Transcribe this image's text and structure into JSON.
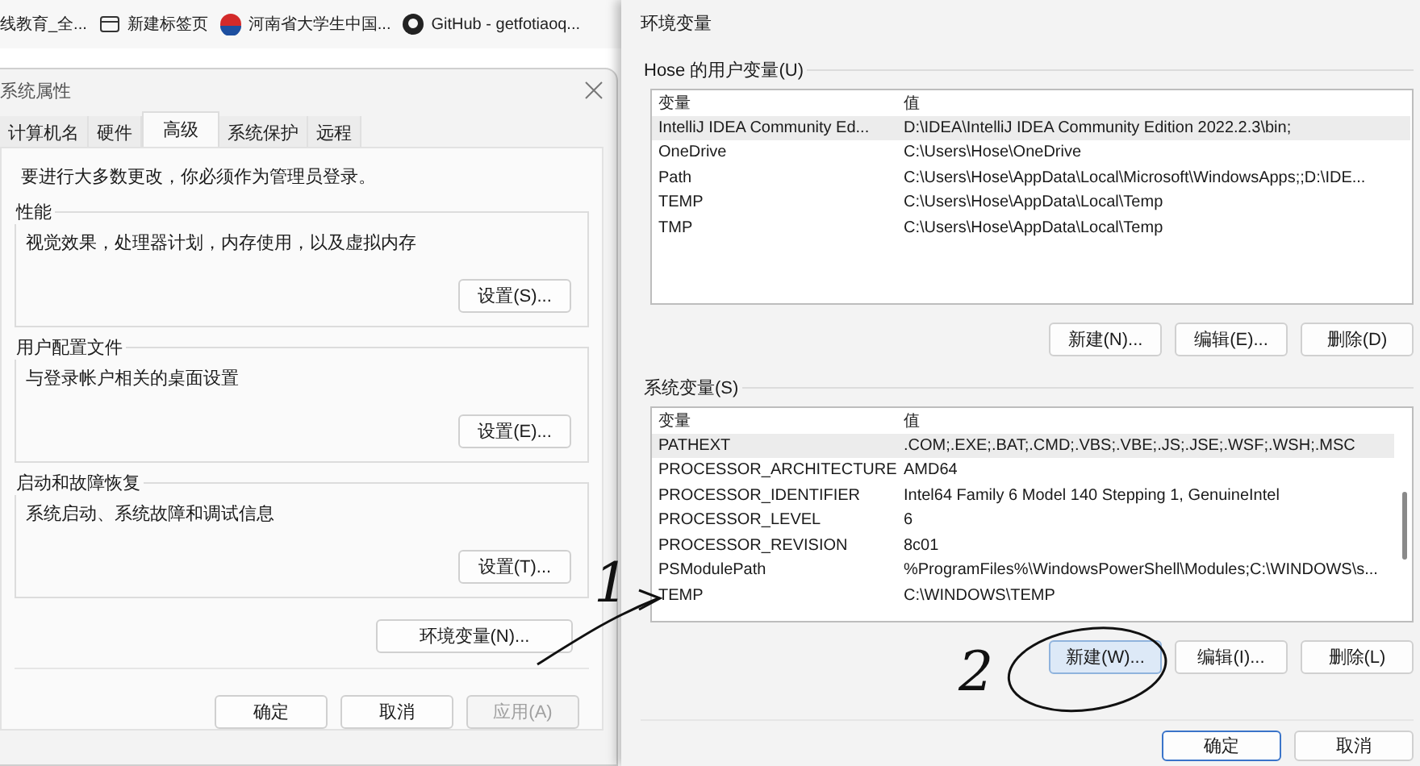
{
  "bookmarks": [
    {
      "label": "线教育_全...",
      "kind": "none"
    },
    {
      "label": "新建标签页",
      "kind": "tab"
    },
    {
      "label": "河南省大学生中国...",
      "kind": "logo"
    },
    {
      "label": "GitHub - getfotiaoq...",
      "kind": "github"
    }
  ],
  "system_properties": {
    "title": "系统属性",
    "tabs": [
      {
        "label": "计算机名",
        "selected": false
      },
      {
        "label": "硬件",
        "selected": false
      },
      {
        "label": "高级",
        "selected": true
      },
      {
        "label": "系统保护",
        "selected": false
      },
      {
        "label": "远程",
        "selected": false
      }
    ],
    "admin_note": "要进行大多数更改，你必须作为管理员登录。",
    "groups": [
      {
        "title": "性能",
        "description": "视觉效果，处理器计划，内存使用，以及虚拟内存",
        "button": "设置(S)..."
      },
      {
        "title": "用户配置文件",
        "description": "与登录帐户相关的桌面设置",
        "button": "设置(E)..."
      },
      {
        "title": "启动和故障恢复",
        "description": "系统启动、系统故障和调试信息",
        "button": "设置(T)..."
      }
    ],
    "env_button": "环境变量(N)...",
    "buttons": [
      {
        "label": "确定",
        "disabled": false
      },
      {
        "label": "取消",
        "disabled": false
      },
      {
        "label": "应用(A)",
        "disabled": true
      }
    ]
  },
  "environment_variables": {
    "title": "环境变量",
    "user_variables": {
      "title": "Hose 的用户变量(U)",
      "columns": [
        "变量",
        "值"
      ],
      "rows": [
        {
          "name": "IntelliJ IDEA Community Ed...",
          "value": "D:\\IDEA\\IntelliJ IDEA Community Edition 2022.2.3\\bin;",
          "selected": true
        },
        {
          "name": "OneDrive",
          "value": "C:\\Users\\Hose\\OneDrive",
          "selected": false
        },
        {
          "name": "Path",
          "value": "C:\\Users\\Hose\\AppData\\Local\\Microsoft\\WindowsApps;;D:\\IDE...",
          "selected": false
        },
        {
          "name": "TEMP",
          "value": "C:\\Users\\Hose\\AppData\\Local\\Temp",
          "selected": false
        },
        {
          "name": "TMP",
          "value": "C:\\Users\\Hose\\AppData\\Local\\Temp",
          "selected": false
        }
      ],
      "buttons": [
        {
          "label": "新建(N)...",
          "focused": false
        },
        {
          "label": "编辑(E)...",
          "focused": false
        },
        {
          "label": "删除(D)",
          "focused": false
        }
      ]
    },
    "system_variables": {
      "title": "系统变量(S)",
      "columns": [
        "变量",
        "值"
      ],
      "rows": [
        {
          "name": "PATHEXT",
          "value": ".COM;.EXE;.BAT;.CMD;.VBS;.VBE;.JS;.JSE;.WSF;.WSH;.MSC",
          "selected": true
        },
        {
          "name": "PROCESSOR_ARCHITECTURE",
          "value": "AMD64",
          "selected": false
        },
        {
          "name": "PROCESSOR_IDENTIFIER",
          "value": "Intel64 Family 6 Model 140 Stepping 1, GenuineIntel",
          "selected": false
        },
        {
          "name": "PROCESSOR_LEVEL",
          "value": "6",
          "selected": false
        },
        {
          "name": "PROCESSOR_REVISION",
          "value": "8c01",
          "selected": false
        },
        {
          "name": "PSModulePath",
          "value": "%ProgramFiles%\\WindowsPowerShell\\Modules;C:\\WINDOWS\\s...",
          "selected": false
        },
        {
          "name": "TEMP",
          "value": "C:\\WINDOWS\\TEMP",
          "selected": false
        }
      ],
      "buttons": [
        {
          "label": "新建(W)...",
          "focused": true
        },
        {
          "label": "编辑(I)...",
          "focused": false
        },
        {
          "label": "删除(L)",
          "focused": false
        }
      ]
    },
    "buttons": [
      {
        "label": "确定",
        "default": true
      },
      {
        "label": "取消",
        "default": false
      }
    ]
  },
  "annotations": [
    {
      "label": "1"
    },
    {
      "label": "2"
    }
  ]
}
